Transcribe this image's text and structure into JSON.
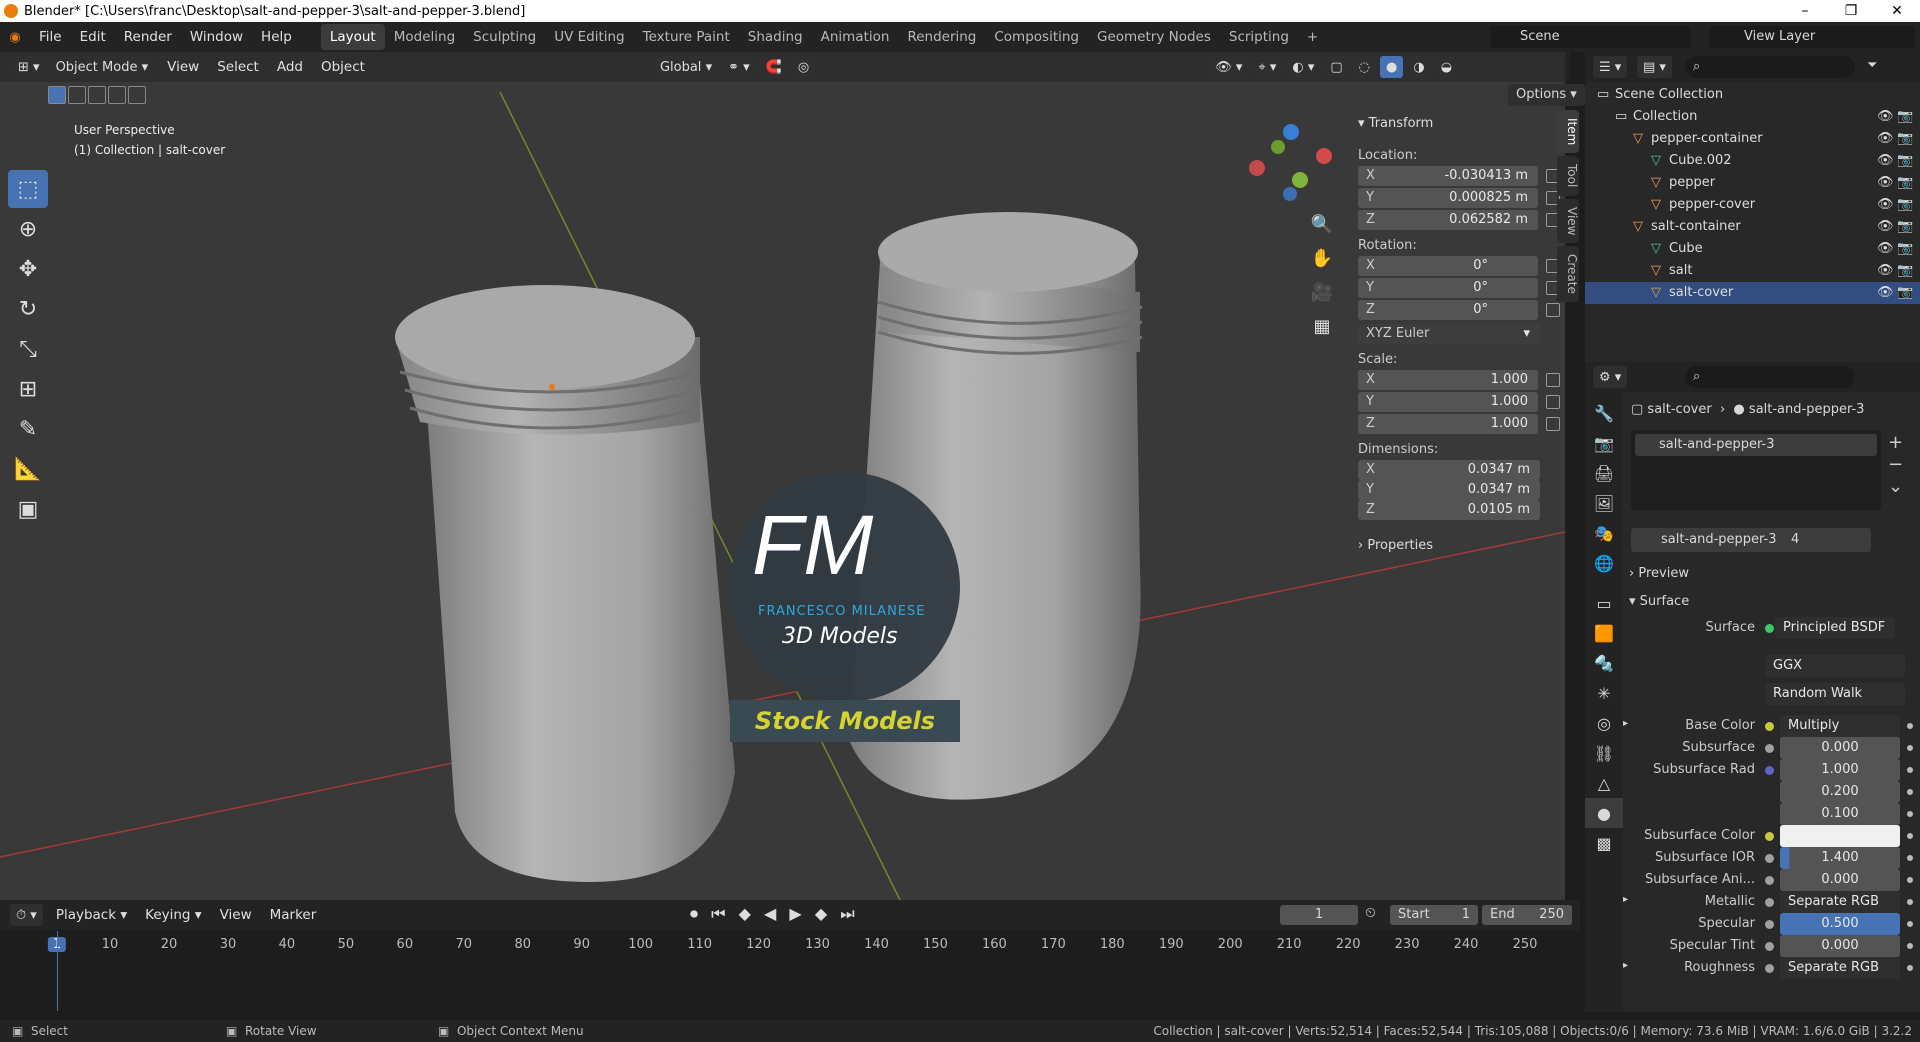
{
  "window": {
    "title": "Blender* [C:\\Users\\franc\\Desktop\\salt-and-pepper-3\\salt-and-pepper-3.blend]"
  },
  "menus": [
    "File",
    "Edit",
    "Render",
    "Window",
    "Help"
  ],
  "workspaces": [
    "Layout",
    "Modeling",
    "Sculpting",
    "UV Editing",
    "Texture Paint",
    "Shading",
    "Animation",
    "Rendering",
    "Compositing",
    "Geometry Nodes",
    "Scripting",
    "+"
  ],
  "active_workspace": "Layout",
  "scene": {
    "scene_name": "Scene",
    "view_layer": "View Layer"
  },
  "viewport_header": {
    "mode": "Object Mode",
    "menus": [
      "View",
      "Select",
      "Add",
      "Object"
    ],
    "orientation": "Global",
    "options": "Options"
  },
  "viewport": {
    "perspective": "User Perspective",
    "context": "(1) Collection | salt-cover"
  },
  "watermark": {
    "initials": "FM",
    "name": "FRANCESCO MILANESE",
    "sub": "3D Models",
    "banner": "Stock Models"
  },
  "npanel": {
    "title": "Transform",
    "location_label": "Location:",
    "location": {
      "x": "-0.030413 m",
      "y": "0.000825 m",
      "z": "0.062582 m"
    },
    "rotation_label": "Rotation:",
    "rotation": {
      "x": "0°",
      "y": "0°",
      "z": "0°"
    },
    "rotation_mode": "XYZ Euler",
    "scale_label": "Scale:",
    "scale": {
      "x": "1.000",
      "y": "1.000",
      "z": "1.000"
    },
    "dimensions_label": "Dimensions:",
    "dimensions": {
      "x": "0.0347 m",
      "y": "0.0347 m",
      "z": "0.0105 m"
    },
    "properties": "Properties",
    "tabs": [
      "Item",
      "Tool",
      "View",
      "Create"
    ]
  },
  "outliner": {
    "items": [
      {
        "label": "Scene Collection",
        "depth": 0,
        "icon": "collection-icon"
      },
      {
        "label": "Collection",
        "depth": 1,
        "icon": "collection-icon"
      },
      {
        "label": "pepper-container",
        "depth": 2,
        "icon": "object-icon"
      },
      {
        "label": "Cube.002",
        "depth": 3,
        "icon": "mesh-icon"
      },
      {
        "label": "pepper",
        "depth": 3,
        "icon": "object-icon"
      },
      {
        "label": "pepper-cover",
        "depth": 3,
        "icon": "object-icon"
      },
      {
        "label": "salt-container",
        "depth": 2,
        "icon": "object-icon"
      },
      {
        "label": "Cube",
        "depth": 3,
        "icon": "mesh-icon"
      },
      {
        "label": "salt",
        "depth": 3,
        "icon": "object-icon"
      },
      {
        "label": "salt-cover",
        "depth": 3,
        "icon": "object-icon"
      }
    ]
  },
  "properties": {
    "breadcrumb_object": "salt-cover",
    "breadcrumb_material": "salt-and-pepper-3",
    "slot": "salt-and-pepper-3",
    "material_name": "salt-and-pepper-3",
    "users": "4",
    "preview": "Preview",
    "surface_section": "Surface",
    "surface_label": "Surface",
    "surface_value": "Principled BSDF",
    "distribution": "GGX",
    "sss_method": "Random Walk",
    "rows": [
      {
        "label": "Base Color",
        "value": "Multiply",
        "dot": "#c8c83c",
        "kind": "link"
      },
      {
        "label": "Subsurface",
        "value": "0.000",
        "dot": "#a0a0a0",
        "kind": "num"
      },
      {
        "label": "Subsurface Rad",
        "value": "1.000",
        "dot": "#6363c7",
        "kind": "num"
      },
      {
        "label": "",
        "value": "0.200",
        "dot": "",
        "kind": "num"
      },
      {
        "label": "",
        "value": "0.100",
        "dot": "",
        "kind": "num"
      },
      {
        "label": "Subsurface Color",
        "value": "",
        "dot": "#c8c83c",
        "kind": "color"
      },
      {
        "label": "Subsurface IOR",
        "value": "1.400",
        "dot": "#a0a0a0",
        "kind": "num",
        "fill": 0.08
      },
      {
        "label": "Subsurface Ani...",
        "value": "0.000",
        "dot": "#a0a0a0",
        "kind": "num"
      },
      {
        "label": "Metallic",
        "value": "Separate RGB",
        "dot": "#a0a0a0",
        "kind": "link"
      },
      {
        "label": "Specular",
        "value": "0.500",
        "dot": "#a0a0a0",
        "kind": "num",
        "fill": 1.0
      },
      {
        "label": "Specular Tint",
        "value": "0.000",
        "dot": "#a0a0a0",
        "kind": "num"
      },
      {
        "label": "Roughness",
        "value": "Separate RGB",
        "dot": "#a0a0a0",
        "kind": "link"
      }
    ]
  },
  "timeline": {
    "menus": [
      "Playback",
      "Keying",
      "View",
      "Marker"
    ],
    "current_frame": "1",
    "start_label": "Start",
    "start": "1",
    "end_label": "End",
    "end": "250",
    "ticks": [
      "1",
      "10",
      "20",
      "30",
      "40",
      "50",
      "60",
      "70",
      "80",
      "90",
      "100",
      "110",
      "120",
      "130",
      "140",
      "150",
      "160",
      "170",
      "180",
      "190",
      "200",
      "210",
      "220",
      "230",
      "240",
      "250"
    ]
  },
  "statusbar": {
    "left": [
      "Select",
      "Rotate View",
      "Object Context Menu"
    ],
    "stats": "Collection | salt-cover | Verts:52,514 | Faces:52,544 | Tris:105,088 | Objects:0/6 | Memory: 73.6 MiB | VRAM: 1.6/6.0 GiB | 3.2.2"
  }
}
